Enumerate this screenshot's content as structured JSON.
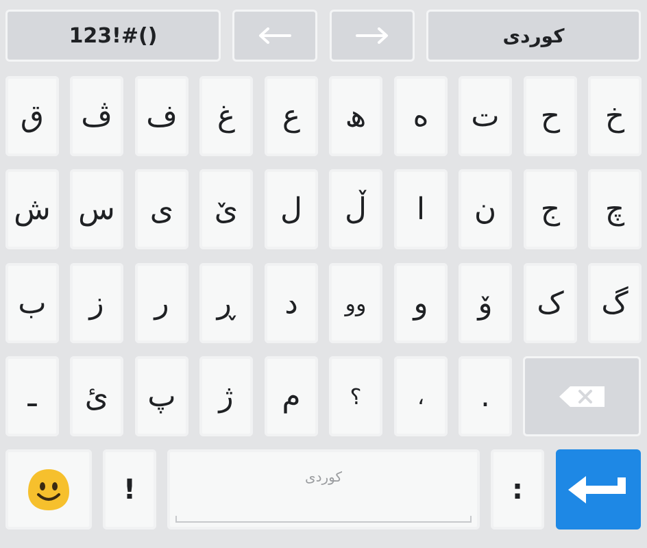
{
  "top_bar": {
    "symbols_label": "123!#()",
    "lang_label": "کوردی",
    "left_arrow_icon": "left-arrow-icon",
    "right_arrow_icon": "right-arrow-icon"
  },
  "rows": [
    [
      "ق",
      "ڤ",
      "ف",
      "غ",
      "ع",
      "ھ",
      "ە",
      "ت",
      "ح",
      "خ"
    ],
    [
      "ش",
      "س",
      "ی",
      "ێ",
      "ل",
      "ڵ",
      "ا",
      "ن",
      "ج",
      "چ"
    ],
    [
      "ب",
      "ز",
      "ر",
      "ڕ",
      "د",
      "وو",
      "و",
      "ۆ",
      "ک",
      "گ"
    ],
    [
      "ـ",
      "ئ",
      "پ",
      "ژ",
      "م",
      "؟",
      "،",
      "."
    ]
  ],
  "bottom_row": {
    "emoji_icon": "smiley-emoji-icon",
    "exclamation_label": "!",
    "space_label": "کوردی",
    "colon_label": ":",
    "enter_icon": "enter-arrow-icon",
    "backspace_icon": "backspace-icon"
  },
  "colors": {
    "background": "#e3e4e6",
    "key": "#f7f8f8",
    "function_key": "#d6d8dc",
    "enter": "#1e88e5",
    "emoji": "#f6c02d"
  }
}
